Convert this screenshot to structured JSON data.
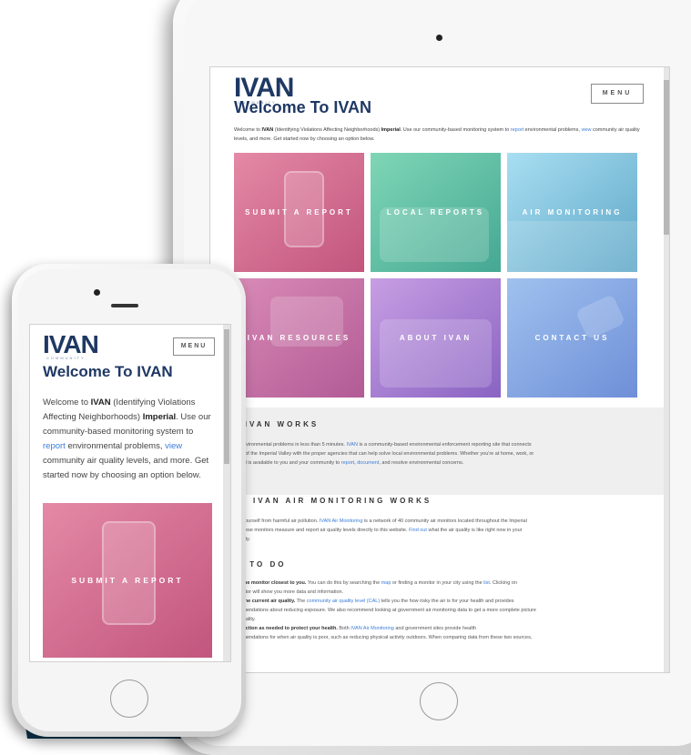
{
  "colors": {
    "background_shape": "#0e3a52",
    "brand": "#1f3864",
    "link": "#3b7dd8"
  },
  "site": {
    "logo_text": "IVAN",
    "logo_sub": "COMMUNITY",
    "menu_label": "MENU",
    "welcome_title": "Welcome To IVAN",
    "intro": {
      "p1": "Welcome to ",
      "ivan": "IVAN",
      "p2": " (Identifying Violations Affecting Neighborhoods) ",
      "imperial": "Imperial",
      "p3": ". Use our community-based monitoring system to ",
      "report_link": "report",
      "p4": " environmental problems, ",
      "view_link": "view",
      "p5": " community air quality levels, and more. Get started now by choosing an option below."
    },
    "tiles": [
      {
        "label": "SUBMIT A REPORT"
      },
      {
        "label": "LOCAL REPORTS"
      },
      {
        "label": "AIR MONITORING"
      },
      {
        "label": "IVAN RESOURCES"
      },
      {
        "label": "ABOUT IVAN"
      },
      {
        "label": "CONTACT US"
      }
    ],
    "how_works": {
      "heading": "W IVAN WORKS",
      "text_a": "port environmental problems in less than 5 minutes. ",
      "ivan_link": "IVAN",
      "text_b": " is a community-based environmental enforcement reporting site that connects",
      "text_c": "idents of the Imperial Valley with the proper agencies that can help solve local environmental problems. Whether you're at home, work, or",
      "text_d": "y, IVAN is available to you and your community to ",
      "report_link": "report",
      "text_e": ", ",
      "document_link": "document",
      "text_f": ", and resolve environmental concerns."
    },
    "air_works": {
      "heading": "OW IVAN AIR MONITORING WORKS",
      "text_a": "otect yourself from harmful air pollution. ",
      "air_link": "IVAN Air Monitoring",
      "text_b": " is a network of 40 community air monitors located throughout the Imperial",
      "text_c": "ley. These monitors measure and report air quality levels directly to this website. ",
      "find_link": "Find out",
      "text_d": " what the air quality is like right now in your",
      "text_e": "mmunity."
    },
    "what_to_do": {
      "heading": "AT TO DO",
      "s1_bold": "Find the monitor closest to you.",
      "s1_a": " You can do this by searching the ",
      "map_link": "map",
      "s1_b": " or finding a monitor in your city using the ",
      "list_link": "list",
      "s1_c": ". Clicking on",
      "s1_d": "e monitor will show you more data and information.",
      "s2_bold": "View the current air quality.",
      "s2_a": " The ",
      "cal_link": "community air quality level (CAL)",
      "s2_b": " tells you the how risky the air is for your health and provides",
      "s2_c": "ecommendations about reducing exposure. We also recommend looking at government air monitoring data to get a more complete picture",
      "s2_d": "f air quality.",
      "s3_bold": "Take action as needed to protect your health.",
      "s3_a": " Both ",
      "s3_link": "IVAN Air Monitoring",
      "s3_b": " and government sites provide health",
      "s3_c": "ecommendations for when air quality is poor, such as reducing physical activity outdoors. When comparing data from these two sources,"
    }
  }
}
